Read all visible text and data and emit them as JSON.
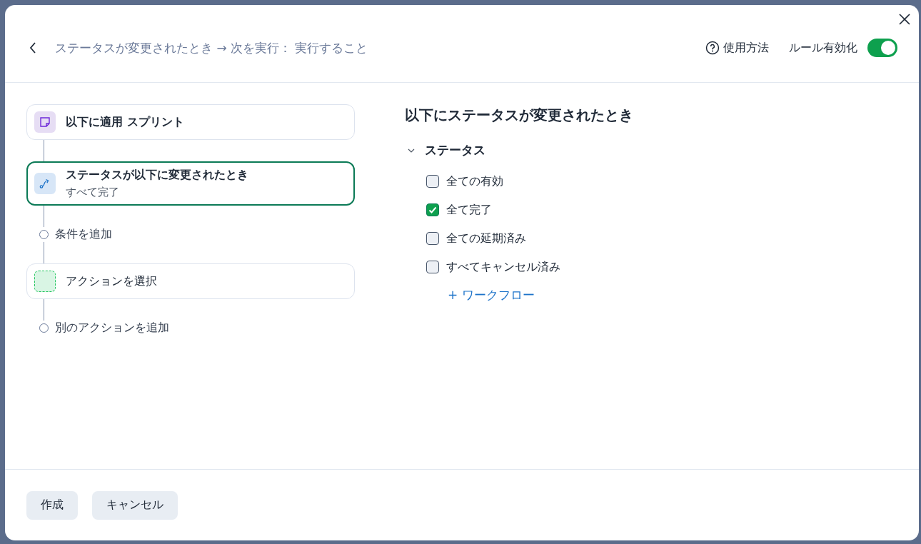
{
  "header": {
    "breadcrumb": "ステータスが変更されたとき → 次を実行： 実行すること",
    "help": "使用方法",
    "rule_toggle": {
      "label": "ルール有効化",
      "on": true
    }
  },
  "flow": [
    {
      "kind": "scope",
      "title": "以下に適用 スプリント",
      "selected": false
    },
    {
      "kind": "trigger",
      "title": "ステータスが以下に変更されたとき",
      "subtitle": "すべて完了",
      "selected": true
    },
    {
      "kind": "add",
      "label": "条件を追加"
    },
    {
      "kind": "action",
      "title": "アクションを選択",
      "selected": false
    },
    {
      "kind": "add",
      "label": "別のアクションを追加"
    }
  ],
  "panel": {
    "title": "以下にステータスが変更されたとき",
    "group": {
      "label": "ステータス",
      "expanded": true,
      "options": [
        {
          "label": "全ての有効",
          "checked": false
        },
        {
          "label": "全て完了",
          "checked": true
        },
        {
          "label": "全ての延期済み",
          "checked": false
        },
        {
          "label": "すべてキャンセル済み",
          "checked": false
        }
      ],
      "add_link": "+ ワークフロー"
    }
  },
  "buttons": [
    "作成",
    "キャンセル"
  ]
}
